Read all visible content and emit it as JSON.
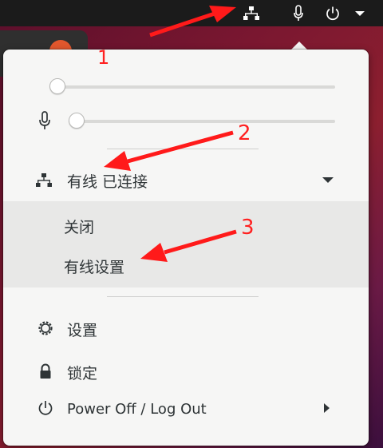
{
  "topbar": {
    "icons": [
      "network-wired-icon",
      "microphone-icon",
      "power-icon",
      "menu-dropdown-icon"
    ]
  },
  "menu": {
    "volume_level": 0.0,
    "mic_level": 0.0,
    "wired": {
      "label": "有线 已连接",
      "items": {
        "off": "关闭",
        "settings": "有线设置"
      }
    },
    "settings_label": "设置",
    "lock_label": "锁定",
    "power_label": "Power Off / Log Out"
  },
  "annotations": [
    "1",
    "2",
    "3"
  ],
  "colors": {
    "menu_bg": "#f6f6f5",
    "submenu_bg": "#e8e8e7",
    "topbar_bg": "#1b1b1b",
    "annotation_red": "#ff2020"
  }
}
